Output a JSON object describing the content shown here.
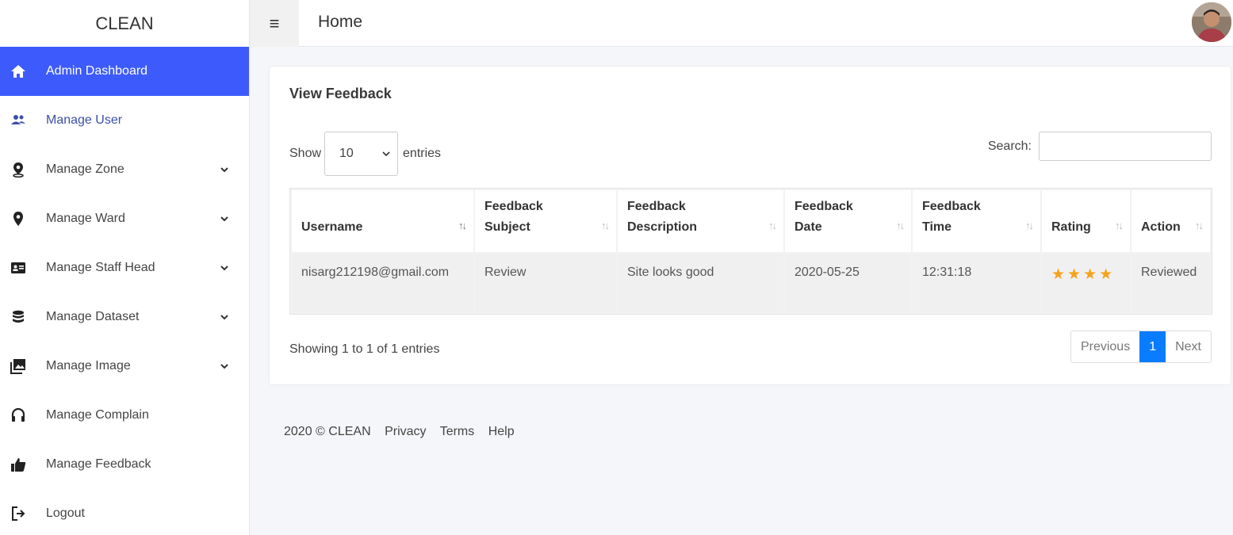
{
  "brand": "CLEAN",
  "topbar": {
    "menu_icon": "≡",
    "title": "Home"
  },
  "sidebar": {
    "items": [
      {
        "label": "Admin Dashboard",
        "icon": "home-icon"
      },
      {
        "label": "Manage User",
        "icon": "users-icon"
      },
      {
        "label": "Manage Zone",
        "icon": "map-marker-icon"
      },
      {
        "label": "Manage Ward",
        "icon": "location-pin-icon"
      },
      {
        "label": "Manage Staff Head",
        "icon": "id-card-icon"
      },
      {
        "label": "Manage Dataset",
        "icon": "database-icon"
      },
      {
        "label": "Manage Image",
        "icon": "image-icon"
      },
      {
        "label": "Manage Complain",
        "icon": "headset-icon"
      },
      {
        "label": "Manage Feedback",
        "icon": "thumbs-up-icon"
      },
      {
        "label": "Logout",
        "icon": "logout-icon"
      }
    ]
  },
  "card": {
    "title": "View Feedback",
    "show_label": "Show",
    "entries_value": "10",
    "entries_label": "entries",
    "search_label": "Search:",
    "search_value": ""
  },
  "table": {
    "headers": [
      {
        "line1": "Username",
        "line2": ""
      },
      {
        "line1": "Feedback",
        "line2": "Subject"
      },
      {
        "line1": "Feedback",
        "line2": "Description"
      },
      {
        "line1": "Feedback",
        "line2": "Date"
      },
      {
        "line1": "Feedback",
        "line2": "Time"
      },
      {
        "line1": "Rating",
        "line2": ""
      },
      {
        "line1": "Action",
        "line2": ""
      }
    ],
    "rows": [
      {
        "username": "nisarg212198@gmail.com",
        "subject": "Review",
        "description": "Site looks good",
        "date": "2020-05-25",
        "time": "12:31:18",
        "rating": 4,
        "rating_display": "★★★★",
        "action": "Reviewed"
      }
    ]
  },
  "info_text": "Showing 1 to 1 of 1 entries",
  "pagination": {
    "previous": "Previous",
    "current": "1",
    "next": "Next"
  },
  "footer": {
    "copyright": "2020 © CLEAN",
    "links": [
      "Privacy",
      "Terms",
      "Help"
    ]
  },
  "colors": {
    "accent": "#3d5bfc",
    "page_active": "#0a7cff",
    "star": "#f7a21b"
  }
}
